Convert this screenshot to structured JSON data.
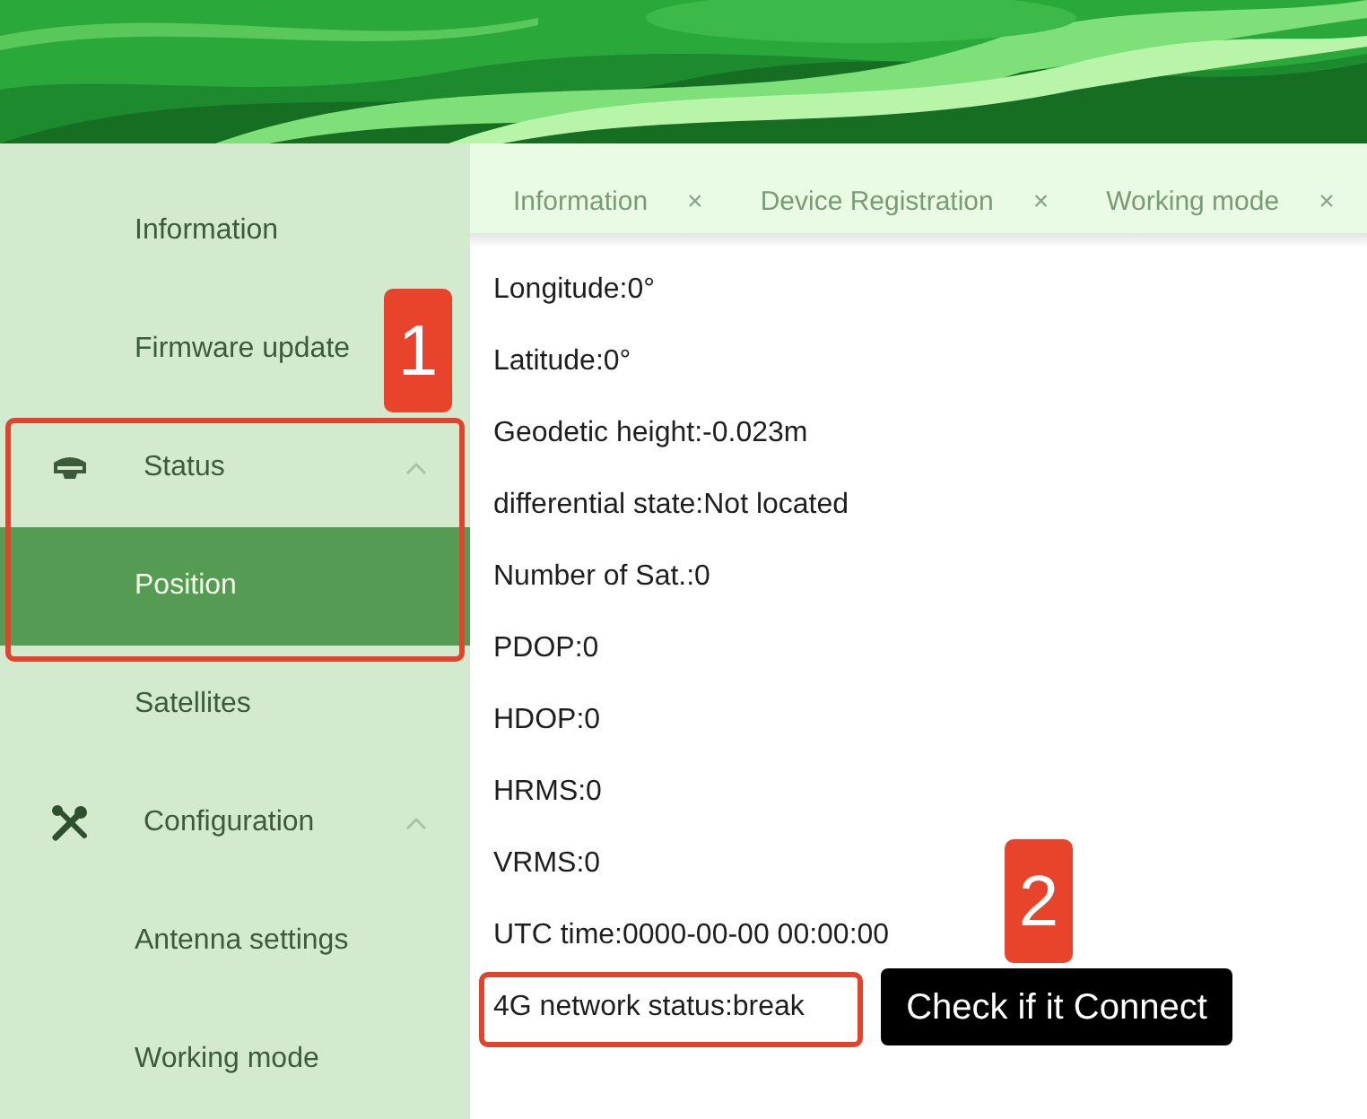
{
  "sidebar": {
    "items": [
      {
        "kind": "item",
        "label": "Information",
        "selected": false
      },
      {
        "kind": "item",
        "label": "Firmware update",
        "selected": false
      },
      {
        "kind": "group",
        "label": "Status",
        "expanded": true,
        "children": [
          {
            "label": "Position",
            "selected": true
          },
          {
            "label": "Satellites",
            "selected": false
          }
        ]
      },
      {
        "kind": "group",
        "label": "Configuration",
        "expanded": true,
        "children": [
          {
            "label": "Antenna settings",
            "selected": false
          },
          {
            "label": "Working mode",
            "selected": false
          }
        ]
      }
    ]
  },
  "tabs": [
    {
      "label": "Information",
      "close": "×",
      "selected": false
    },
    {
      "label": "Device Registration",
      "close": "×",
      "selected": false
    },
    {
      "label": "Working mode",
      "close": "×",
      "selected": false
    }
  ],
  "status_lines": [
    "Longitude:0°",
    "Latitude:0°",
    "Geodetic height:-0.023m",
    "differential state:Not located",
    "Number of Sat.:0",
    "PDOP:0",
    "HDOP:0",
    "HRMS:0",
    "VRMS:0",
    "UTC time:0000-00-00 00:00:00",
    "4G network status:break"
  ],
  "annotations": {
    "markers": [
      "1",
      "2"
    ],
    "callout": "Check if it Connect"
  }
}
